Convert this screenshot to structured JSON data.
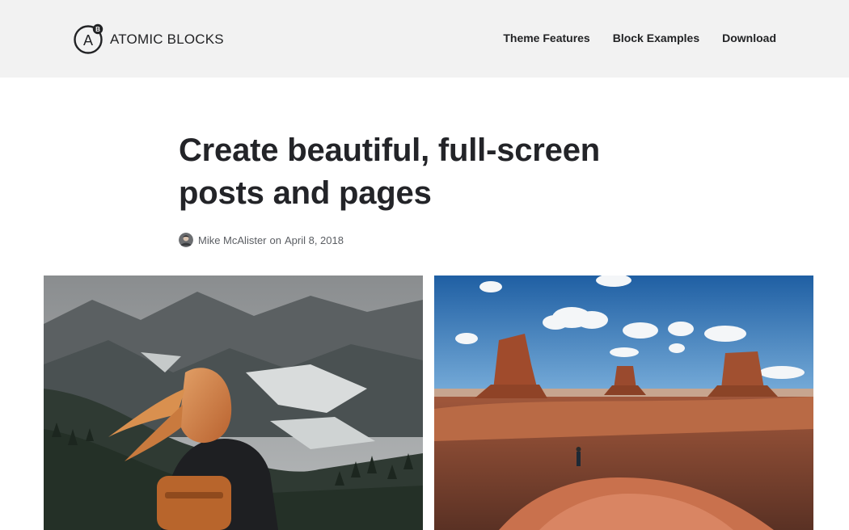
{
  "header": {
    "logo": {
      "badge_letter": "A",
      "badge_superscript": "B",
      "text": "ATOMIC BLOCKS"
    },
    "nav": [
      {
        "label": "Theme Features"
      },
      {
        "label": "Block Examples"
      },
      {
        "label": "Download"
      }
    ]
  },
  "post": {
    "title_line1": "Create beautiful, full-screen",
    "title_line2": "posts and pages",
    "author": "Mike McAlister",
    "on_text": "on",
    "date": "April 8, 2018"
  },
  "gallery": [
    {
      "icon": "photo-mountain-hiker"
    },
    {
      "icon": "photo-desert-buttes"
    }
  ],
  "colors": {
    "header_bg": "#f2f2f2",
    "text": "#222325",
    "meta": "#5b5e63",
    "sky": "#2f6fae",
    "desert": "#b5583a"
  }
}
